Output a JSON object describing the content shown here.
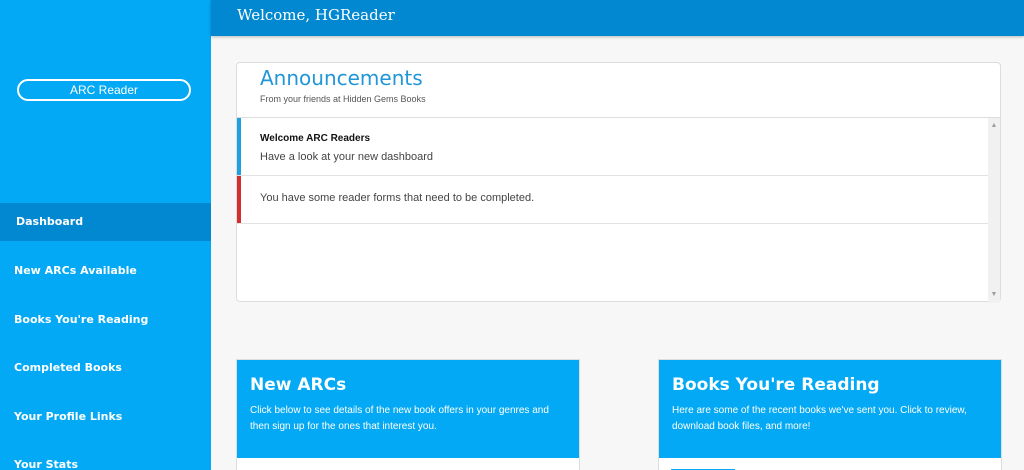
{
  "sidebar": {
    "role_label": "ARC Reader",
    "nav": [
      {
        "label": "Dashboard",
        "active": true
      },
      {
        "label": "New ARCs Available"
      },
      {
        "label": "Books You're Reading"
      },
      {
        "label": "Completed Books"
      },
      {
        "label": "Your Profile Links"
      },
      {
        "label": "Your Stats"
      }
    ]
  },
  "header": {
    "welcome": "Welcome, HGReader"
  },
  "announcements": {
    "title": "Announcements",
    "subtitle": "From your friends at Hidden Gems Books",
    "items": [
      {
        "title": "Welcome ARC Readers",
        "body": "Have a look at your new dashboard",
        "accent": "#1e9fe0"
      },
      {
        "title": "",
        "body": "You have some reader forms that need to be completed.",
        "accent": "#d32f2f"
      }
    ]
  },
  "cards": {
    "new_arcs": {
      "title": "New ARCs",
      "description": "Click below to see details of the new book offers in your genres and then sign up for the ones that interest you."
    },
    "reading": {
      "title": "Books You're Reading",
      "description": "Here are some of the recent books we've sent you. Click to review, download book files, and more!"
    }
  },
  "colors": {
    "sidebar": "#03a9f4",
    "header": "#0288d1",
    "active_nav": "#0288d1",
    "accent_blue": "#1e9fe0",
    "accent_red": "#d32f2f"
  }
}
